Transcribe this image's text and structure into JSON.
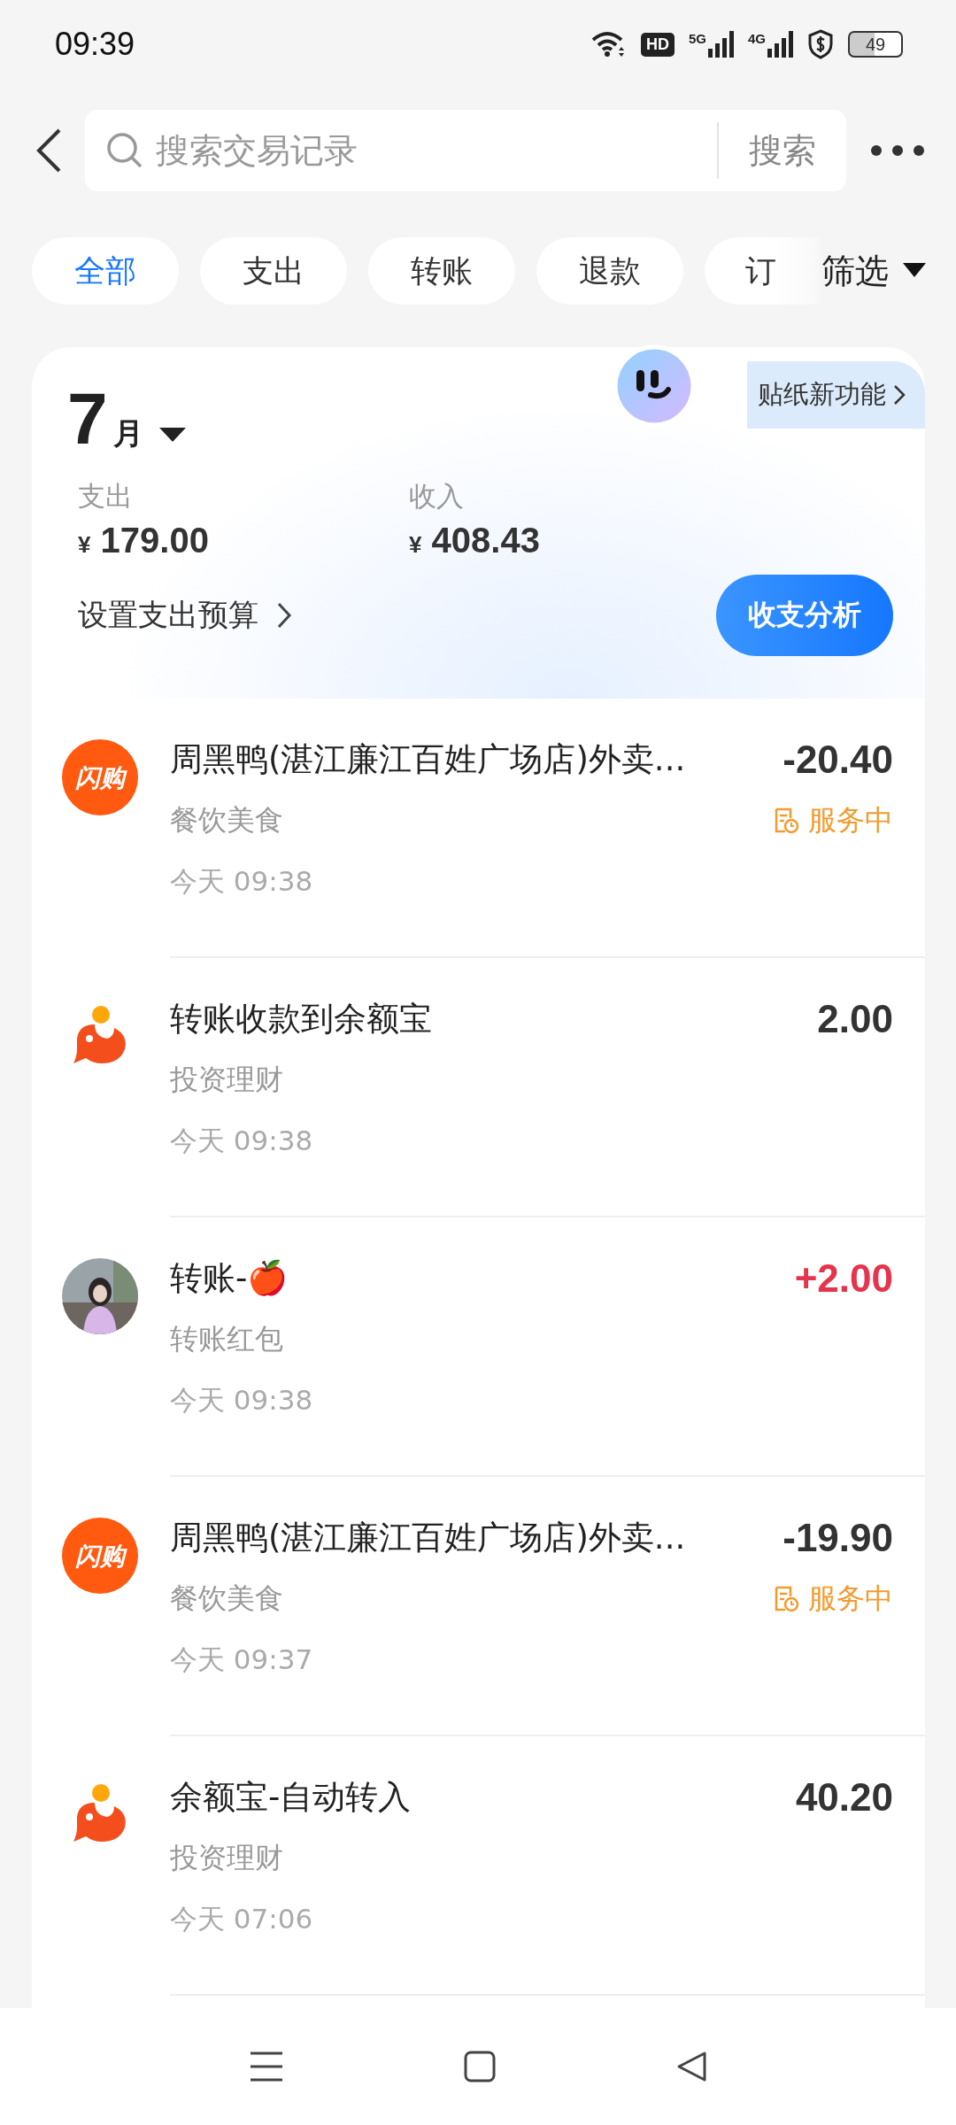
{
  "status_bar": {
    "time": "09:39",
    "hd": "HD",
    "networks": [
      "5G",
      "4G"
    ],
    "battery": "49"
  },
  "search": {
    "placeholder": "搜索交易记录",
    "button": "搜索"
  },
  "chips": [
    {
      "label": "全部",
      "selected": true
    },
    {
      "label": "支出",
      "selected": false
    },
    {
      "label": "转账",
      "selected": false
    },
    {
      "label": "退款",
      "selected": false
    },
    {
      "label": "订",
      "selected": false
    }
  ],
  "filter": "筛选",
  "summary": {
    "month": "7",
    "month_unit": "月",
    "sticker_link": "贴纸新功能",
    "expense_label": "支出",
    "expense": "179.00",
    "income_label": "收入",
    "income": "408.43",
    "currency": "¥",
    "budget_link": "设置支出预算",
    "analysis_button": "收支分析"
  },
  "transactions": [
    {
      "kind": "shop",
      "logo_text": "闪购",
      "title": "周黑鸭(湛江廉江百姓广场店)外卖...",
      "category": "餐饮美食",
      "time": "今天 09:38",
      "amount": "-20.40",
      "color": "#333333",
      "status": "服务中"
    },
    {
      "kind": "fund",
      "title": "转账收款到余额宝",
      "category": "投资理财",
      "time": "今天 09:38",
      "amount": "2.00",
      "color": "#333333"
    },
    {
      "kind": "person",
      "title": "转账-🍎",
      "category": "转账红包",
      "time": "今天 09:38",
      "amount": "+2.00",
      "color": "#e5344b"
    },
    {
      "kind": "shop",
      "logo_text": "闪购",
      "title": "周黑鸭(湛江廉江百姓广场店)外卖...",
      "category": "餐饮美食",
      "time": "今天 09:37",
      "amount": "-19.90",
      "color": "#333333",
      "status": "服务中"
    },
    {
      "kind": "fund",
      "title": "余额宝-自动转入",
      "category": "投资理财",
      "time": "今天 07:06",
      "amount": "40.20",
      "color": "#333333"
    }
  ]
}
